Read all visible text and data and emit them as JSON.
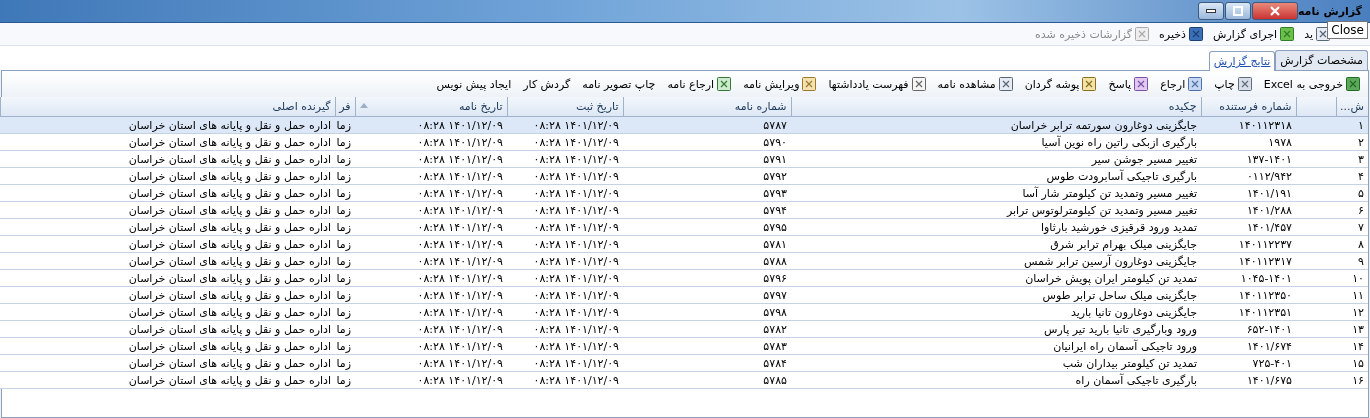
{
  "window": {
    "title": "گزارش نامه",
    "tooltip": "Close"
  },
  "menu": [
    {
      "label": "ید",
      "disabled": false
    },
    {
      "label": "اجرای گزارش",
      "disabled": false
    },
    {
      "label": "ذخیره",
      "disabled": false
    },
    {
      "label": "گزارشات ذخیره شده",
      "disabled": true
    }
  ],
  "tabs": [
    {
      "label": "مشخصات گزارش",
      "selected": false
    },
    {
      "label": "نتایج گزارش",
      "selected": true
    }
  ],
  "toolbar": [
    {
      "label": "خروجی به Excel",
      "kind": "iconed"
    },
    {
      "label": "چاپ",
      "kind": "iconed"
    },
    {
      "label": "ارجاع",
      "kind": "iconed"
    },
    {
      "label": "پاسخ",
      "kind": "iconed"
    },
    {
      "label": "پوشه گردان",
      "kind": "iconed"
    },
    {
      "label": "مشاهده نامه",
      "kind": "iconed"
    },
    {
      "label": "فهرست یادداشتها",
      "kind": "iconed"
    },
    {
      "label": "ویرایش نامه",
      "kind": "iconed"
    },
    {
      "label": "ارجاع نامه",
      "kind": "iconed"
    },
    {
      "label": "چاپ تصویر نامه",
      "kind": "plain"
    },
    {
      "label": "گردش کار",
      "kind": "plain"
    },
    {
      "label": "ایجاد پیش نویس",
      "kind": "plain"
    }
  ],
  "table": {
    "columns": [
      {
        "kind": "data",
        "label": "ش...",
        "sorted": false
      },
      {
        "kind": "blank",
        "sorted": false
      },
      {
        "kind": "data",
        "label": "شماره فرستنده",
        "sorted": false
      },
      {
        "kind": "data",
        "label": "چکیده",
        "sorted": false
      },
      {
        "kind": "data",
        "label": "شماره نامه",
        "sorted": false
      },
      {
        "kind": "data",
        "label": "تاریخ ثبت",
        "sorted": false
      },
      {
        "kind": "data",
        "label": "تاریخ نامه",
        "sorted": true
      },
      {
        "kind": "data",
        "label": "فر",
        "sorted": false
      },
      {
        "kind": "data",
        "label": "گیرنده اصلی",
        "sorted": false
      }
    ],
    "rows": [
      {
        "selected": true,
        "cells": [
          "۱",
          "",
          "۱۴۰۱۱۲۳۱۸",
          "جایگزینی دوغارون سورتمه ترابر خراسان",
          "۵۷۸۷",
          "۱۴۰۱/۱۲/۰۹ ۰۸:۲۸",
          "۱۴۰۱/۱۲/۰۹ ۰۸:۲۸",
          "زما",
          "اداره حمل و نقل و پایانه های استان خراسان"
        ]
      },
      {
        "selected": false,
        "cells": [
          "۲",
          "",
          "۱۹۷۸",
          "بارگیری ازبکی راتین راه نوین آسیا",
          "۵۷۹۰",
          "۱۴۰۱/۱۲/۰۹ ۰۸:۲۸",
          "۱۴۰۱/۱۲/۰۹ ۰۸:۲۸",
          "زما",
          "اداره حمل و نقل و پایانه های استان خراسان"
        ]
      },
      {
        "selected": false,
        "cells": [
          "۳",
          "",
          "۱۳۷-۱۴۰۱",
          "تغییر مسیر جوشن سیر",
          "۵۷۹۱",
          "۱۴۰۱/۱۲/۰۹ ۰۸:۲۸",
          "۱۴۰۱/۱۲/۰۹ ۰۸:۲۸",
          "زما",
          "اداره حمل و نقل و پایانه های استان خراسان"
        ]
      },
      {
        "selected": false,
        "cells": [
          "۴",
          "",
          "۰۱۱۲/۹۴۲",
          "بارگیری تاجیکی آسابرودت طوس",
          "۵۷۹۲",
          "۱۴۰۱/۱۲/۰۹ ۰۸:۲۸",
          "۱۴۰۱/۱۲/۰۹ ۰۸:۲۸",
          "زما",
          "اداره حمل و نقل و پایانه های استان خراسان"
        ]
      },
      {
        "selected": false,
        "cells": [
          "۵",
          "",
          "۱۴۰۱/۱۹۱",
          "تغییر مسیر وتمدید تن کیلومتر شار آسا",
          "۵۷۹۳",
          "۱۴۰۱/۱۲/۰۹ ۰۸:۲۸",
          "۱۴۰۱/۱۲/۰۹ ۰۸:۲۸",
          "زما",
          "اداره حمل و نقل و پایانه های استان خراسان"
        ]
      },
      {
        "selected": false,
        "cells": [
          "۶",
          "",
          "۱۴۰۱/۲۸۸",
          "تغییر مسیر وتمدید تن کیلومترلوتوس ترابر",
          "۵۷۹۴",
          "۱۴۰۱/۱۲/۰۹ ۰۸:۲۸",
          "۱۴۰۱/۱۲/۰۹ ۰۸:۲۸",
          "زما",
          "اداره حمل و نقل و پایانه های استان خراسان"
        ]
      },
      {
        "selected": false,
        "cells": [
          "۷",
          "",
          "۱۴۰۱/۴۵۷",
          "تمدید ورود قرقیزی خورشید بارثاوا",
          "۵۷۹۵",
          "۱۴۰۱/۱۲/۰۹ ۰۸:۲۸",
          "۱۴۰۱/۱۲/۰۹ ۰۸:۲۸",
          "زما",
          "اداره حمل و نقل و پایانه های استان خراسان"
        ]
      },
      {
        "selected": false,
        "cells": [
          "۸",
          "",
          "۱۴۰۱۱۲۲۳۷",
          "جایگزینی میلک بهرام ترابر شرق",
          "۵۷۸۱",
          "۱۴۰۱/۱۲/۰۹ ۰۸:۲۸",
          "۱۴۰۱/۱۲/۰۹ ۰۸:۲۸",
          "زما",
          "اداره حمل و نقل و پایانه های استان خراسان"
        ]
      },
      {
        "selected": false,
        "cells": [
          "۹",
          "",
          "۱۴۰۱۱۲۳۱۷",
          "جایگزینی دوغارون آرسین ترابر شمس",
          "۵۷۸۸",
          "۱۴۰۱/۱۲/۰۹ ۰۸:۲۸",
          "۱۴۰۱/۱۲/۰۹ ۰۸:۲۸",
          "زما",
          "اداره حمل و نقل و پایانه های استان خراسان"
        ]
      },
      {
        "selected": false,
        "cells": [
          "۱۰",
          "",
          "۱۰۴۵-۱۴۰۱",
          "تمدید تن کیلومتر ایران پویش خراسان",
          "۵۷۹۶",
          "۱۴۰۱/۱۲/۰۹ ۰۸:۲۸",
          "۱۴۰۱/۱۲/۰۹ ۰۸:۲۸",
          "زما",
          "اداره حمل و نقل و پایانه های استان خراسان"
        ]
      },
      {
        "selected": false,
        "cells": [
          "۱۱",
          "",
          "۱۴۰۱۱۲۳۵۰",
          "جایگزینی میلک ساحل ترابر طوس",
          "۵۷۹۷",
          "۱۴۰۱/۱۲/۰۹ ۰۸:۲۸",
          "۱۴۰۱/۱۲/۰۹ ۰۸:۲۸",
          "زما",
          "اداره حمل و نقل و پایانه های استان خراسان"
        ]
      },
      {
        "selected": false,
        "cells": [
          "۱۲",
          "",
          "۱۴۰۱۱۲۳۵۱",
          "جایگزینی دوغارون تانیا بارید",
          "۵۷۹۸",
          "۱۴۰۱/۱۲/۰۹ ۰۸:۲۸",
          "۱۴۰۱/۱۲/۰۹ ۰۸:۲۸",
          "زما",
          "اداره حمل و نقل و پایانه های استان خراسان"
        ]
      },
      {
        "selected": false,
        "cells": [
          "۱۳",
          "",
          "۶۵۲-۱۴۰۱",
          "ورود وبارگیری تانیا بارید تیر پارس",
          "۵۷۸۲",
          "۱۴۰۱/۱۲/۰۹ ۰۸:۲۸",
          "۱۴۰۱/۱۲/۰۹ ۰۸:۲۸",
          "زما",
          "اداره حمل و نقل و پایانه های استان خراسان"
        ]
      },
      {
        "selected": false,
        "cells": [
          "۱۴",
          "",
          "۱۴۰۱/۶۷۴",
          "ورود تاجیکی آسمان راه ایرانیان",
          "۵۷۸۳",
          "۱۴۰۱/۱۲/۰۹ ۰۸:۲۸",
          "۱۴۰۱/۱۲/۰۹ ۰۸:۲۸",
          "زما",
          "اداره حمل و نقل و پایانه های استان خراسان"
        ]
      },
      {
        "selected": false,
        "cells": [
          "۱۵",
          "",
          "۷۲۵-۴۰۱",
          "تمدید تن کیلومتر بیداران شب",
          "۵۷۸۴",
          "۱۴۰۱/۱۲/۰۹ ۰۸:۲۸",
          "۱۴۰۱/۱۲/۰۹ ۰۸:۲۸",
          "زما",
          "اداره حمل و نقل و پایانه های استان خراسان"
        ]
      },
      {
        "selected": false,
        "cells": [
          "۱۶",
          "",
          "۱۴۰۱/۶۷۵",
          "بارگیری تاجیکی آسمان راه",
          "۵۷۸۵",
          "۱۴۰۱/۱۲/۰۹ ۰۸:۲۸",
          "۱۴۰۱/۱۲/۰۹ ۰۸:۲۸",
          "زما",
          "اداره حمل و نقل و پایانه های استان خراسان"
        ]
      }
    ]
  }
}
